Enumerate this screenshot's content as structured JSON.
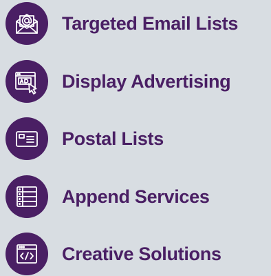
{
  "services": [
    {
      "label": "Targeted Email Lists",
      "icon": "email-envelope-icon"
    },
    {
      "label": "Display Advertising",
      "icon": "display-ad-cursor-icon"
    },
    {
      "label": "Postal Lists",
      "icon": "postal-card-icon"
    },
    {
      "label": "Append Services",
      "icon": "database-servers-icon"
    },
    {
      "label": "Creative Solutions",
      "icon": "code-window-icon"
    }
  ],
  "colors": {
    "background": "#d8dde2",
    "accent": "#4a1f64",
    "icon_stroke": "#ffffff"
  }
}
